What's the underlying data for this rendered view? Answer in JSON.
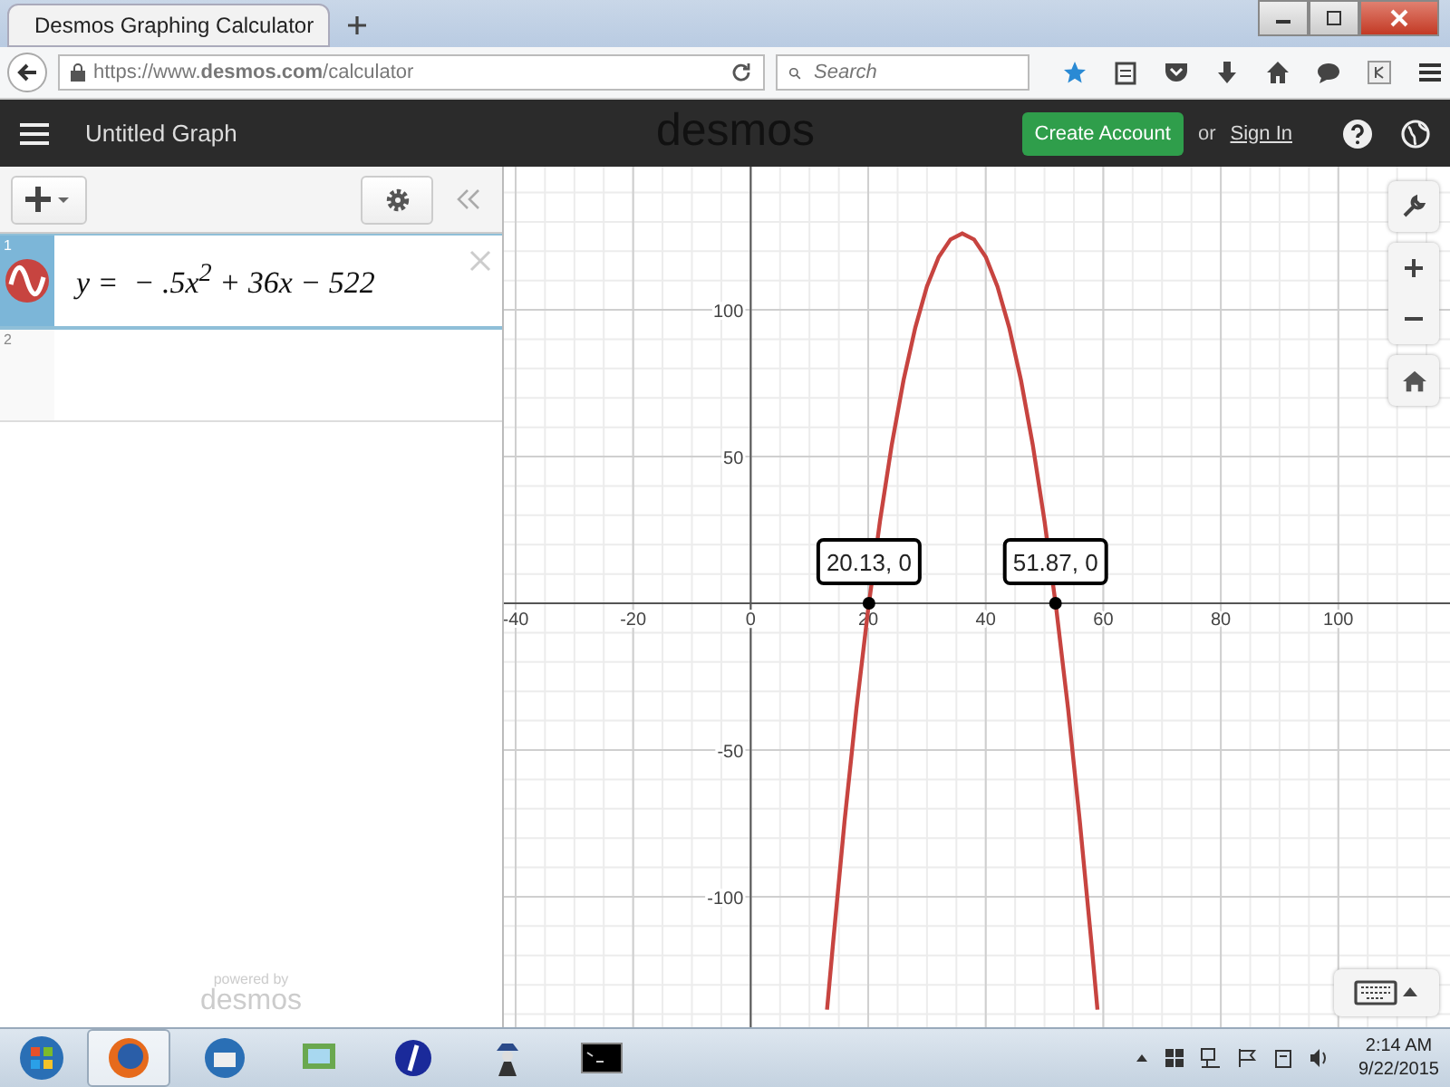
{
  "browser": {
    "tab": {
      "title": "Desmos Graphing Calculator"
    },
    "url": "https://www.**desmos.com**/calculator",
    "search": {
      "placeholder": "Search"
    }
  },
  "header": {
    "title": "Untitled Graph",
    "logo": "desmos",
    "create_account": "Create Account",
    "or": "or",
    "sign_in": "Sign In"
  },
  "expressions": [
    {
      "index": "1",
      "latex": "y =  − .5x$^{2}$ + 36x − 522",
      "color": "#c74440",
      "selected": true
    },
    {
      "index": "2",
      "selected": false
    }
  ],
  "footer": {
    "powered_by": "powered by",
    "brand": "desmos"
  },
  "graph": {
    "chart_data": {
      "type": "line",
      "x": [
        13,
        14,
        16,
        18,
        20,
        22,
        24,
        26,
        28,
        30,
        32,
        34,
        36,
        38,
        40,
        42,
        44,
        46,
        48,
        50,
        52,
        54,
        56,
        58,
        59
      ],
      "series": [
        {
          "color": "#c74440",
          "values": [
            -138.5,
            -116,
            -74,
            -36,
            -2,
            28,
            54,
            76,
            94,
            108,
            118,
            124,
            126,
            124,
            118,
            108,
            94,
            76,
            54,
            28,
            -2,
            -36,
            -74,
            -116,
            -138.5
          ]
        }
      ],
      "xlim": [
        -42,
        119
      ],
      "ylim": [
        -145.7,
        148.8
      ],
      "grid": true,
      "xticks": [
        -40,
        -20,
        0,
        20,
        40,
        60,
        80,
        100
      ],
      "yticks": [
        -100,
        -50,
        50,
        100
      ],
      "annotations": [
        {
          "x": 20.13,
          "y": 0,
          "text": "20.13, 0"
        },
        {
          "x": 51.87,
          "y": 0,
          "text": "51.87, 0"
        }
      ]
    }
  },
  "taskbar": {
    "time": "2:14 AM",
    "date": "9/22/2015"
  }
}
